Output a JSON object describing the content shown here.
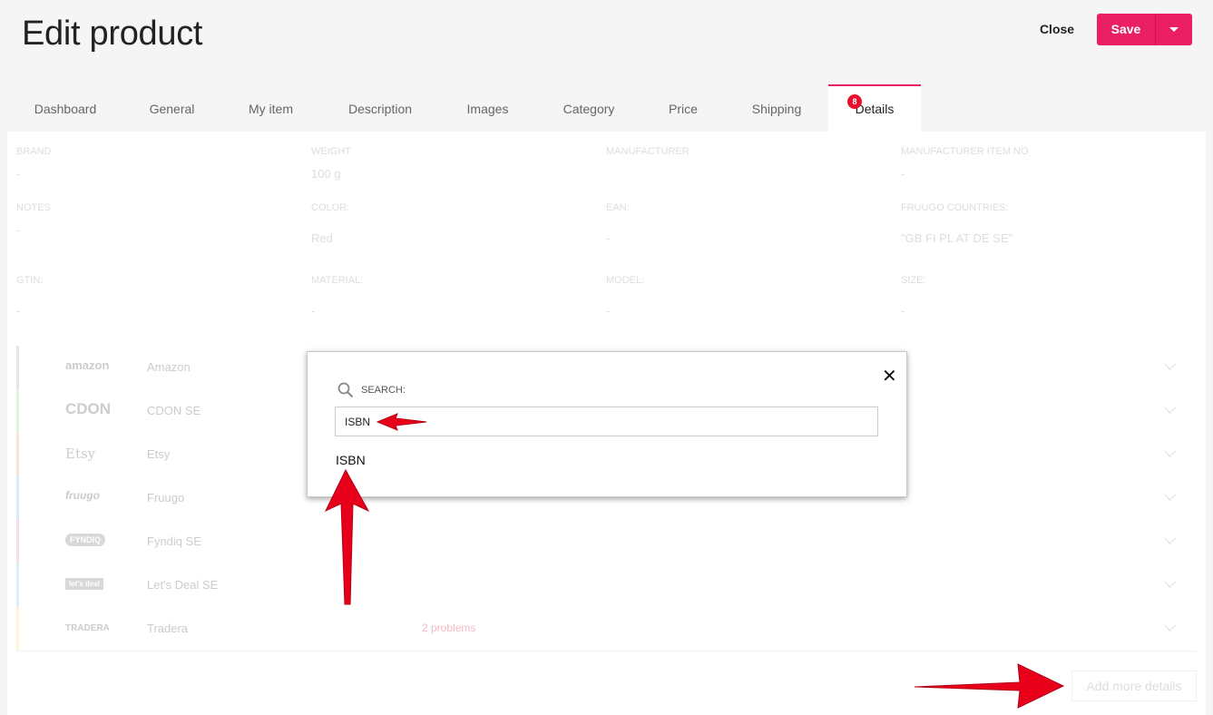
{
  "header": {
    "title": "Edit product",
    "close_label": "Close",
    "save_label": "Save"
  },
  "tabs": [
    {
      "label": "Dashboard"
    },
    {
      "label": "General"
    },
    {
      "label": "My item"
    },
    {
      "label": "Description"
    },
    {
      "label": "Images"
    },
    {
      "label": "Category"
    },
    {
      "label": "Price"
    },
    {
      "label": "Shipping"
    },
    {
      "label": "Details",
      "badge": "8",
      "active": true
    }
  ],
  "fields": [
    {
      "label": "BRAND",
      "value": "-"
    },
    {
      "label": "WEIGHT",
      "value": "100 g"
    },
    {
      "label": "MANUFACTURER",
      "value": ""
    },
    {
      "label": "MANUFACTURER ITEM NO",
      "value": "-"
    },
    {
      "label": "NOTES",
      "value": "-"
    },
    {
      "label": "COLOR:",
      "value": "Red"
    },
    {
      "label": "EAN:",
      "value": "-"
    },
    {
      "label": "FRUUGO COUNTRIES:",
      "value": "\"GB FI PL AT DE SE\""
    },
    {
      "label": "GTIN:",
      "value": "-"
    },
    {
      "label": "MATERIAL:",
      "value": "-"
    },
    {
      "label": "MODEL:",
      "value": "-"
    },
    {
      "label": "SIZE:",
      "value": "-"
    }
  ],
  "marketplaces": [
    {
      "logo": "amazon",
      "name": "Amazon",
      "problems": "",
      "color": "#e6e6e6"
    },
    {
      "logo": "CDON",
      "name": "CDON SE",
      "problems": "",
      "color": "#e3f3d9"
    },
    {
      "logo": "Etsy",
      "name": "Etsy",
      "problems": "",
      "color": "#fde3d6"
    },
    {
      "logo": "fruugo",
      "name": "Fruugo",
      "problems": "",
      "color": "#dbeafb"
    },
    {
      "logo": "FYNDIQ",
      "name": "Fyndiq SE",
      "problems": "",
      "color": "#fadde2"
    },
    {
      "logo": "let's deal",
      "name": "Let's Deal SE",
      "problems": "",
      "color": "#d9f1f6"
    },
    {
      "logo": "TRADERA",
      "name": "Tradera",
      "problems": "2 problems",
      "color": "#fdf6d9"
    }
  ],
  "add_more_label": "Add more details",
  "modal": {
    "search_label": "SEARCH:",
    "search_value": "ISBN",
    "result": "ISBN",
    "close_symbol": "✕"
  },
  "colors": {
    "accent": "#e91e63",
    "annotation": "#e8001a"
  }
}
